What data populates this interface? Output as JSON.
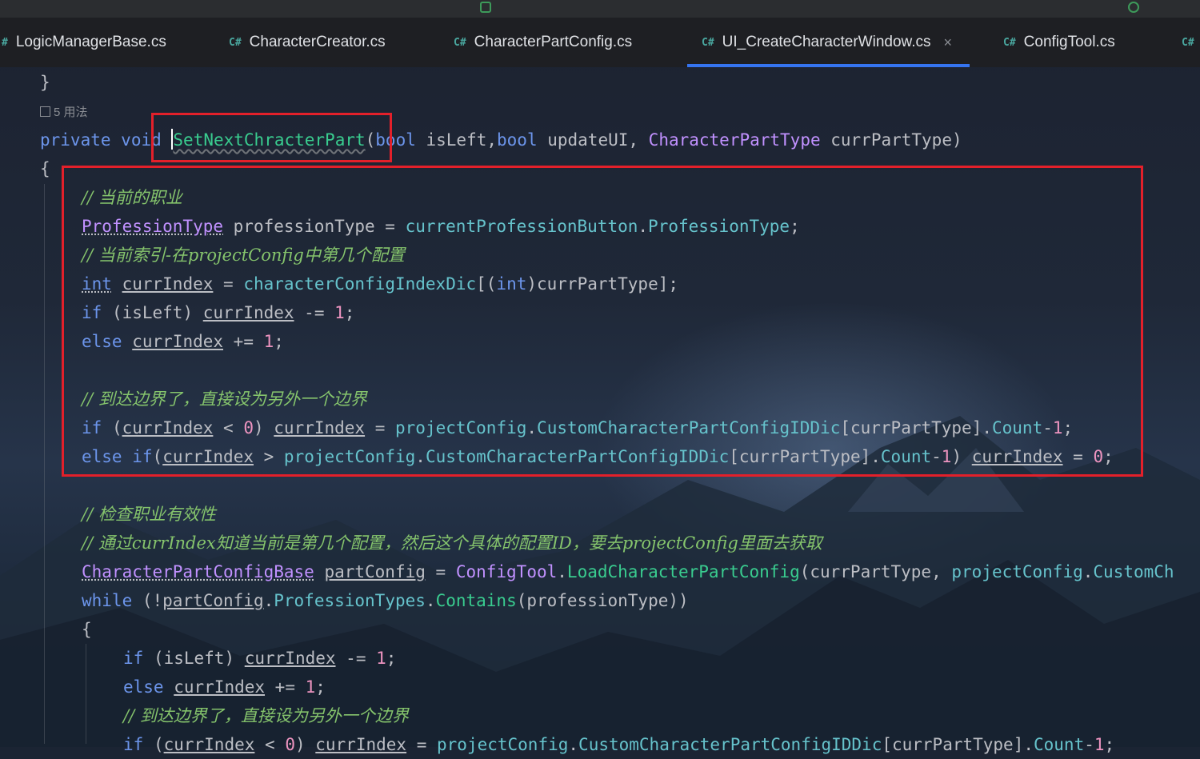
{
  "tabs": [
    {
      "label": "LogicManagerBase.cs",
      "icon": "csharp-file-icon",
      "prefix": "#"
    },
    {
      "label": "CharacterCreator.cs",
      "icon": "csharp-file-icon",
      "prefix": "C#"
    },
    {
      "label": "CharacterPartConfig.cs",
      "icon": "csharp-file-icon",
      "prefix": "C#"
    },
    {
      "label": "UI_CreateCharacterWindow.cs",
      "icon": "csharp-file-icon",
      "prefix": "C#",
      "active": true
    },
    {
      "label": "ConfigTool.cs",
      "icon": "csharp-file-icon",
      "prefix": "C#"
    },
    {
      "label": "",
      "icon": "csharp-file-icon",
      "prefix": "C#"
    }
  ],
  "close_glyph": "×",
  "usage_hint": "5 用法",
  "colors": {
    "keyword": "#6c95eb",
    "type": "#c191ff",
    "method": "#39cc8f",
    "field": "#66c3cc",
    "number": "#ed94c0",
    "comment": "#85c46c",
    "highlight_box": "#e3202a",
    "active_tab": "#3574f0"
  },
  "code": {
    "l0": "}",
    "sig": {
      "private": "private",
      "void": "void",
      "name": "SetNextChracterPart",
      "bool1": "bool",
      "p1": " isLeft,",
      "bool2": "bool",
      "p2": " updateUI, ",
      "enum": "CharacterPartType",
      "p3": " currPartType)"
    },
    "brace_open": "{",
    "c1": "// 当前的职业",
    "l_prof": {
      "type": "ProfessionType",
      "rest": " professionType = ",
      "obj": "currentProfessionButton",
      "dot": ".",
      "prop": "ProfessionType",
      "end": ";"
    },
    "c2": "// 当前索引-在projectConfig中第几个配置",
    "l_idx": {
      "int": "int",
      "var": "currIndex",
      "mid": " = ",
      "dict": "characterConfigIndexDic",
      "b1": "[(",
      "int2": "int",
      "end": ")currPartType];"
    },
    "l_if1": {
      "if": "if",
      "cond": " (isLeft) ",
      "var": "currIndex",
      "op": " -= ",
      "n": "1",
      "end": ";"
    },
    "l_else1": {
      "else": "else",
      "var": "currIndex",
      "op": " += ",
      "n": "1",
      "end": ";"
    },
    "c3": "// 到达边界了，直接设为另外一个边界",
    "l_if2": {
      "if": "if",
      "p": " (",
      "var": "currIndex",
      "lt": " < ",
      "zero": "0",
      "close": ") ",
      "var2": "currIndex",
      "eq": " = ",
      "pc": "projectConfig",
      "dot": ".",
      "dic": "CustomCharacterPartConfigIDDic",
      "idx": "[currPartType].",
      "count": "Count",
      "minus": "-",
      "one": "1",
      "end": ";"
    },
    "l_else2": {
      "else": "else",
      "if": "if",
      "p": "(",
      "var": "currIndex",
      "gt": " > ",
      "pc": "projectConfig",
      "dot": ".",
      "dic": "CustomCharacterPartConfigIDDic",
      "idx": "[currPartType].",
      "count": "Count",
      "minus": "-",
      "one": "1",
      "close": ") ",
      "var2": "currIndex",
      "eq": " = ",
      "zero": "0",
      "end": ";"
    },
    "c4": "// 检查职业有效性",
    "c5": "// 通过currIndex知道当前是第几个配置，然后这个具体的配置ID，要去projectConfig里面去获取",
    "l_cfg": {
      "type": "CharacterPartConfigBase",
      "sp": " ",
      "var": "partConfig",
      "eq": " = ",
      "cls": "ConfigTool",
      "dot": ".",
      "fn": "LoadCharacterPartConfig",
      "args": "(currPartType, ",
      "pc": "projectConfig",
      "dot2": ".",
      "tail": "CustomCh"
    },
    "l_while": {
      "while": "while",
      "p": " (!",
      "var": "partConfig",
      "dot": ".",
      "prop": "ProfessionTypes",
      "dot2": ".",
      "fn": "Contains",
      "end": "(professionType))"
    },
    "brace_open2": "{",
    "l_if3": {
      "if": "if",
      "cond": " (isLeft) ",
      "var": "currIndex",
      "op": " -= ",
      "n": "1",
      "end": ";"
    },
    "l_else3": {
      "else": "else",
      "var": "currIndex",
      "op": " += ",
      "n": "1",
      "end": ";"
    },
    "c6": "// 到达边界了，直接设为另外一个边界",
    "l_if4": {
      "if": "if",
      "p": " (",
      "var": "currIndex",
      "lt": " < ",
      "zero": "0",
      "close": ") ",
      "var2": "currIndex",
      "eq": " = ",
      "pc": "projectConfig",
      "dot": ".",
      "dic": "CustomCharacterPartConfigIDDic",
      "idx": "[currPartType].",
      "count": "Count",
      "minus": "-",
      "one": "1",
      "end": ";"
    }
  }
}
